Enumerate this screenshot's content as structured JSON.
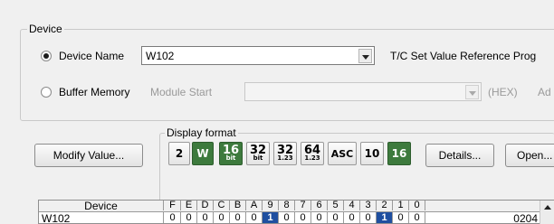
{
  "device_group": {
    "legend": "Device",
    "device_name": {
      "label": "Device Name",
      "value": "W102"
    },
    "tc_label": "T/C Set Value Reference Prog",
    "buffer_memory": {
      "label": "Buffer Memory",
      "module_start_label": "Module Start",
      "hex_label": "(HEX)",
      "ad_label": "Ad"
    }
  },
  "modify_value_label": "Modify Value...",
  "display_format": {
    "legend": "Display format",
    "buttons": [
      {
        "name": "2",
        "label": "2",
        "selected": false
      },
      {
        "name": "w",
        "label": "W",
        "selected": true
      },
      {
        "name": "16bit",
        "top": "16",
        "bottom": "bit",
        "selected": false
      },
      {
        "name": "32bit",
        "top": "32",
        "bottom": "bit",
        "selected": false
      },
      {
        "name": "32-float",
        "top": "32",
        "bottom": "1.23",
        "selected": false
      },
      {
        "name": "64-float",
        "top": "64",
        "bottom": "1.23",
        "selected": false
      },
      {
        "name": "asc",
        "label": "ASC",
        "selected": false
      },
      {
        "name": "10",
        "label": "10",
        "selected": false
      },
      {
        "name": "16",
        "label": "16",
        "selected": true
      }
    ]
  },
  "details_label": "Details...",
  "open_label": "Open...",
  "grid": {
    "device_header": "Device",
    "bit_headers": [
      "F",
      "E",
      "D",
      "C",
      "B",
      "A",
      "9",
      "8",
      "7",
      "6",
      "5",
      "4",
      "3",
      "2",
      "1",
      "0"
    ],
    "rows": [
      {
        "device": "W102",
        "bits": [
          "0",
          "0",
          "0",
          "0",
          "0",
          "0",
          "1",
          "0",
          "0",
          "0",
          "0",
          "0",
          "0",
          "1",
          "0",
          "0"
        ],
        "value": "0204"
      }
    ]
  },
  "colors": {
    "selected_format": "#3d7a3d",
    "highlight_bit": "#1f4fa0"
  }
}
